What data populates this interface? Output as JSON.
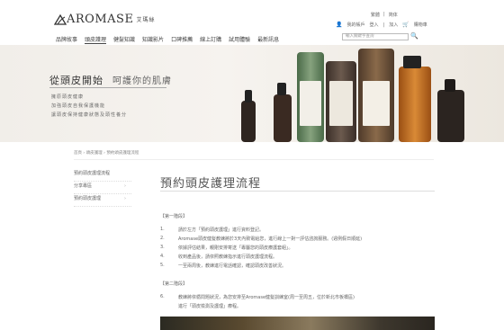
{
  "brand": {
    "name": "AROMASE",
    "sub": "艾瑪絲"
  },
  "langs": [
    "繁體",
    "|",
    "简体"
  ],
  "util": {
    "account": "我的帳戶",
    "login": "登入",
    "join": "加入",
    "cart": "購物車"
  },
  "nav": [
    "品牌故事",
    "頭皮護理",
    "健髮知識",
    "知識影片",
    "口碑推薦",
    "線上訂購",
    "試用體驗",
    "最新訊息"
  ],
  "search": {
    "placeholder": "輸入關鍵字查詢"
  },
  "banner": {
    "title_main": "從頭皮開始",
    "title_light": "呵護你的肌膚",
    "lines": [
      "擁原頭皮健康",
      "加強頭皮自我保護機能",
      "讓頭皮保持健康狀態及頭性養分"
    ]
  },
  "breadcrumb": "首頁 › 頭皮護理 › 預約頭皮護理流程",
  "sidebar": [
    {
      "label": "預約頭皮護理流程"
    },
    {
      "label": "分享專區"
    },
    {
      "label": "預約頭皮護理"
    }
  ],
  "page_title": "預約頭皮護理流程",
  "section1": "【第一階段】",
  "steps1": [
    {
      "num": "1.",
      "text": "請於左方「預約頭皮護理」進行資料登記。"
    },
    {
      "num": "2.",
      "text": "Aromase頭皮健髮教練將於3天內致電給您，進行線上一對一評估諮詢服務。(週例假日順延)"
    },
    {
      "num": "3.",
      "text": "依據評估結果，親剛安排寄送「專屬您的頭皮療護套組」。"
    },
    {
      "num": "4.",
      "text": "收到產品後，請依照教練指示進行頭皮護理流程。"
    },
    {
      "num": "5.",
      "text": "一至兩周後，教練進行電話確認，確認頭皮改善狀況。"
    }
  ],
  "section2": "【第二階段】",
  "steps2": [
    {
      "num": "6.",
      "text": "教練將依循問題狀況，為您安排至Aromase健髮訓練室(周一至周五，位於新北市板橋區)"
    },
    {
      "num": "",
      "text": "進行「頭皮檢測及護理」療程。"
    }
  ],
  "colors": {
    "bottle_dark": "#2e2520",
    "bottle_brown": "#6b4a2e",
    "bottle_amber": "#b8661e",
    "bottle_green": "#4f6a4a"
  }
}
